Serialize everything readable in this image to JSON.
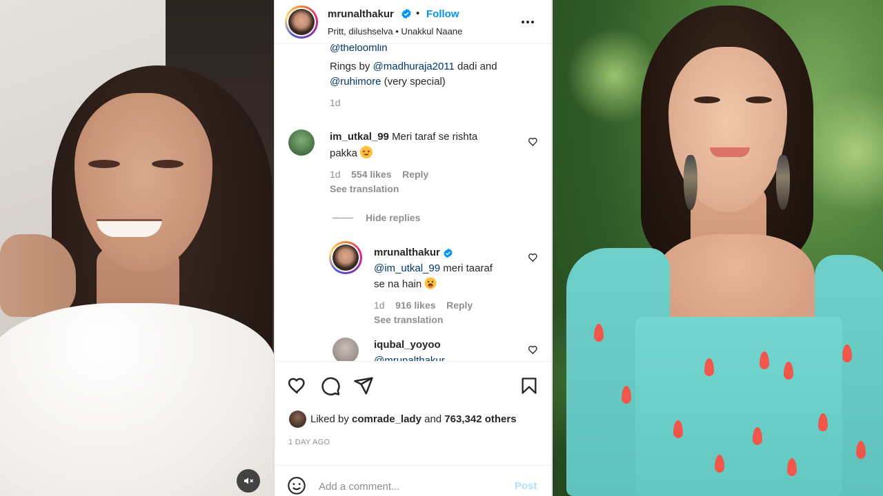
{
  "header": {
    "username": "mrunalthakur",
    "separator": "•",
    "follow_label": "Follow",
    "subline": "Pritt, dilushselva • Unakkul Naane"
  },
  "caption": {
    "cut_line": "@theloomlin",
    "line1_mention": "@madhuraja2011",
    "line1_prefix": "Rings by ",
    "line1_suffix": " dadi and",
    "line2_mention": "@ruhimore",
    "line2_suffix": " (very special)",
    "age": "1d"
  },
  "comments": [
    {
      "username": "im_utkal_99",
      "text_line1": "Meri taraf se rishta",
      "text_line2": "pakka",
      "age": "1d",
      "likes": "554 likes",
      "reply_label": "Reply",
      "see_translation": "See translation"
    }
  ],
  "hide_replies_label": "Hide replies",
  "reply": {
    "username": "mrunalthakur",
    "mention": "@im_utkal_99",
    "text_line1_suffix": " meri taaraf",
    "text_line2": "se na hain",
    "age": "1d",
    "likes": "916 likes",
    "reply_label": "Reply",
    "see_translation": "See translation"
  },
  "partial_comment": {
    "username": "iqubal_yoyoo",
    "text_cut": "@mrunalthakur"
  },
  "footer": {
    "liked_prefix": "Liked by ",
    "liked_user": "comrade_lady",
    "liked_middle": " and ",
    "liked_count": "763,342 others",
    "time_ago": "1 DAY AGO",
    "comment_placeholder": "Add a comment...",
    "post_label": "Post"
  },
  "icons": [
    "mute-icon",
    "more-icon",
    "verified-icon",
    "heart-icon",
    "comment-icon",
    "share-icon",
    "bookmark-icon",
    "emoji-icon"
  ],
  "colors": {
    "accent": "#0095f6",
    "mention": "#00376b",
    "muted": "#8e8e8e",
    "post_disabled": "#b2dffc",
    "text": "#262626"
  }
}
